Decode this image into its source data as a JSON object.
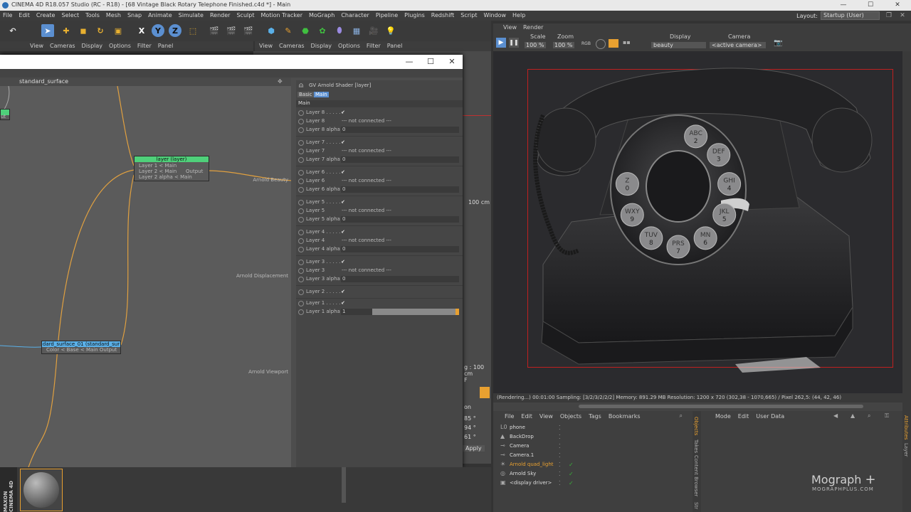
{
  "app": {
    "title": "CINEMA 4D R18.057 Studio (RC - R18) - [68 Vintage Black Rotary Telephone Finished.c4d *] - Main",
    "window_buttons": [
      "—",
      "☐",
      "✕"
    ]
  },
  "menubar": {
    "items": [
      "File",
      "Edit",
      "Create",
      "Select",
      "Tools",
      "Mesh",
      "Snap",
      "Animate",
      "Simulate",
      "Render",
      "Sculpt",
      "Motion Tracker",
      "MoGraph",
      "Character",
      "Pipeline",
      "Plugins",
      "Redshift",
      "Script",
      "Window",
      "Help"
    ],
    "layout_label": "Layout:",
    "layout_value": "Startup (User)"
  },
  "toolbar": {
    "xyz": [
      "X",
      "Y",
      "Z"
    ]
  },
  "left_viewport_menu": [
    "View",
    "Cameras",
    "Display",
    "Options",
    "Filter",
    "Panel"
  ],
  "right_viewport_menu": [
    "View",
    "Cameras",
    "Display",
    "Options",
    "Filter",
    "Panel"
  ],
  "left_viewport": {
    "readout1": "100 cm",
    "readout2": "g : 100 cm",
    "readout3": "F",
    "readout4": "on",
    "vals": [
      "85 °",
      "94 °",
      "61 °"
    ],
    "apply": "Apply"
  },
  "xpresso": {
    "window_buttons": [
      "—",
      "☐",
      "✕"
    ],
    "graph_title": "standard_surface",
    "node_layer": {
      "title": "layer (layer)",
      "ports_in": [
        "Layer 1 < Main",
        "Layer 2 < Main",
        "Layer 2 alpha < Main"
      ],
      "port_out": "Output"
    },
    "node_surface": {
      "title": "dard_surface_01 (standard_sur",
      "port": "Color < Base < Main Output"
    },
    "out_stub": "ut",
    "output_ports": [
      "Arnold Beauty",
      "Arnold Displacement",
      "Arnold Viewport"
    ]
  },
  "attributes": {
    "header": "GV Arnold Shader [layer]",
    "tabs": [
      "Basic",
      "Main"
    ],
    "section": "Main",
    "layers": [
      {
        "name": "Layer 8",
        "dots": "Layer 8 . . . . . .",
        "conn_label": "Layer 8",
        "conn": "--- not connected ---",
        "alpha_label": "Layer 8 alpha",
        "alpha": "0"
      },
      {
        "name": "Layer 7",
        "dots": "Layer 7 . . . . . .",
        "conn_label": "Layer 7",
        "conn": "--- not connected ---",
        "alpha_label": "Layer 7 alpha",
        "alpha": "0"
      },
      {
        "name": "Layer 6",
        "dots": "Layer 6 . . . . . .",
        "conn_label": "Layer 6",
        "conn": "--- not connected ---",
        "alpha_label": "Layer 6 alpha",
        "alpha": "0"
      },
      {
        "name": "Layer 5",
        "dots": "Layer 5 . . . . . .",
        "conn_label": "Layer 5",
        "conn": "--- not connected ---",
        "alpha_label": "Layer 5 alpha",
        "alpha": "0"
      },
      {
        "name": "Layer 4",
        "dots": "Layer 4 . . . . . .",
        "conn_label": "Layer 4",
        "conn": "--- not connected ---",
        "alpha_label": "Layer 4 alpha",
        "alpha": "0"
      },
      {
        "name": "Layer 3",
        "dots": "Layer 3 . . . . . .",
        "conn_label": "Layer 3",
        "conn": "--- not connected ---",
        "alpha_label": "Layer 3 alpha",
        "alpha": "0"
      }
    ],
    "layer2": "Layer 2 . . . . . .",
    "layer1": "Layer 1 . . . . . .",
    "layer1_alpha_label": "Layer 1 alpha",
    "layer1_alpha": "1",
    "check": "✔"
  },
  "render_view": {
    "menu": [
      "View",
      "Render"
    ],
    "scale_label": "Scale",
    "scale_value": "100 %",
    "zoom_label": "Zoom",
    "zoom_value": "100 %",
    "rgb": "RGB",
    "display_label": "Display",
    "display_value": "beauty",
    "camera_label": "Camera",
    "camera_value": "<active camera>",
    "status": "(Rendering...)  00:01:00  Sampling: [3/2/3/2/2/2]  Memory: 891.29 MB  Resolution: 1200 x 720 (302,38 - 1070,665) / Pixel 262,5: (44, 42, 46)",
    "dial_letters": [
      "ABC",
      "DEF",
      "GHI",
      "JKL",
      "MN",
      "PRS",
      "TUV",
      "WXY",
      "Z"
    ],
    "dial_numbers": [
      "2",
      "3",
      "4",
      "5",
      "6",
      "7",
      "8",
      "9",
      "0"
    ]
  },
  "object_manager": {
    "menu": [
      "File",
      "Edit",
      "View",
      "Objects",
      "Tags",
      "Bookmarks"
    ],
    "objects": [
      {
        "name": "phone",
        "icon": "L0",
        "highlight": false
      },
      {
        "name": "BackDrop",
        "icon": "▲",
        "highlight": false
      },
      {
        "name": "Camera",
        "icon": "⊸",
        "highlight": false
      },
      {
        "name": "Camera.1",
        "icon": "⊸",
        "highlight": false
      },
      {
        "name": "Arnold quad_light",
        "icon": "☀",
        "highlight": true
      },
      {
        "name": "Arnold Sky",
        "icon": "◎",
        "highlight": false
      },
      {
        "name": "<display driver>",
        "icon": "▣",
        "highlight": false
      }
    ],
    "side_tabs": [
      "Objects",
      "Takes",
      "Content Browser",
      "Str"
    ]
  },
  "attr_manager": {
    "menu": [
      "Mode",
      "Edit",
      "User Data"
    ],
    "side_tabs": [
      "Attributes",
      "Layer"
    ]
  },
  "watermark": {
    "line1": "Mograph",
    "plus": "+",
    "line2": "MOGRAPHPLUS.COM"
  },
  "maxon_logo": "MAXON CINEMA 4D",
  "colors": {
    "accent_blue": "#5b8fd0",
    "node_green": "#4fd07a",
    "node_blue": "#5ab0e8",
    "wire_orange": "#e0a040",
    "render_border": "#c02020",
    "highlight_orange": "#e8a030"
  }
}
